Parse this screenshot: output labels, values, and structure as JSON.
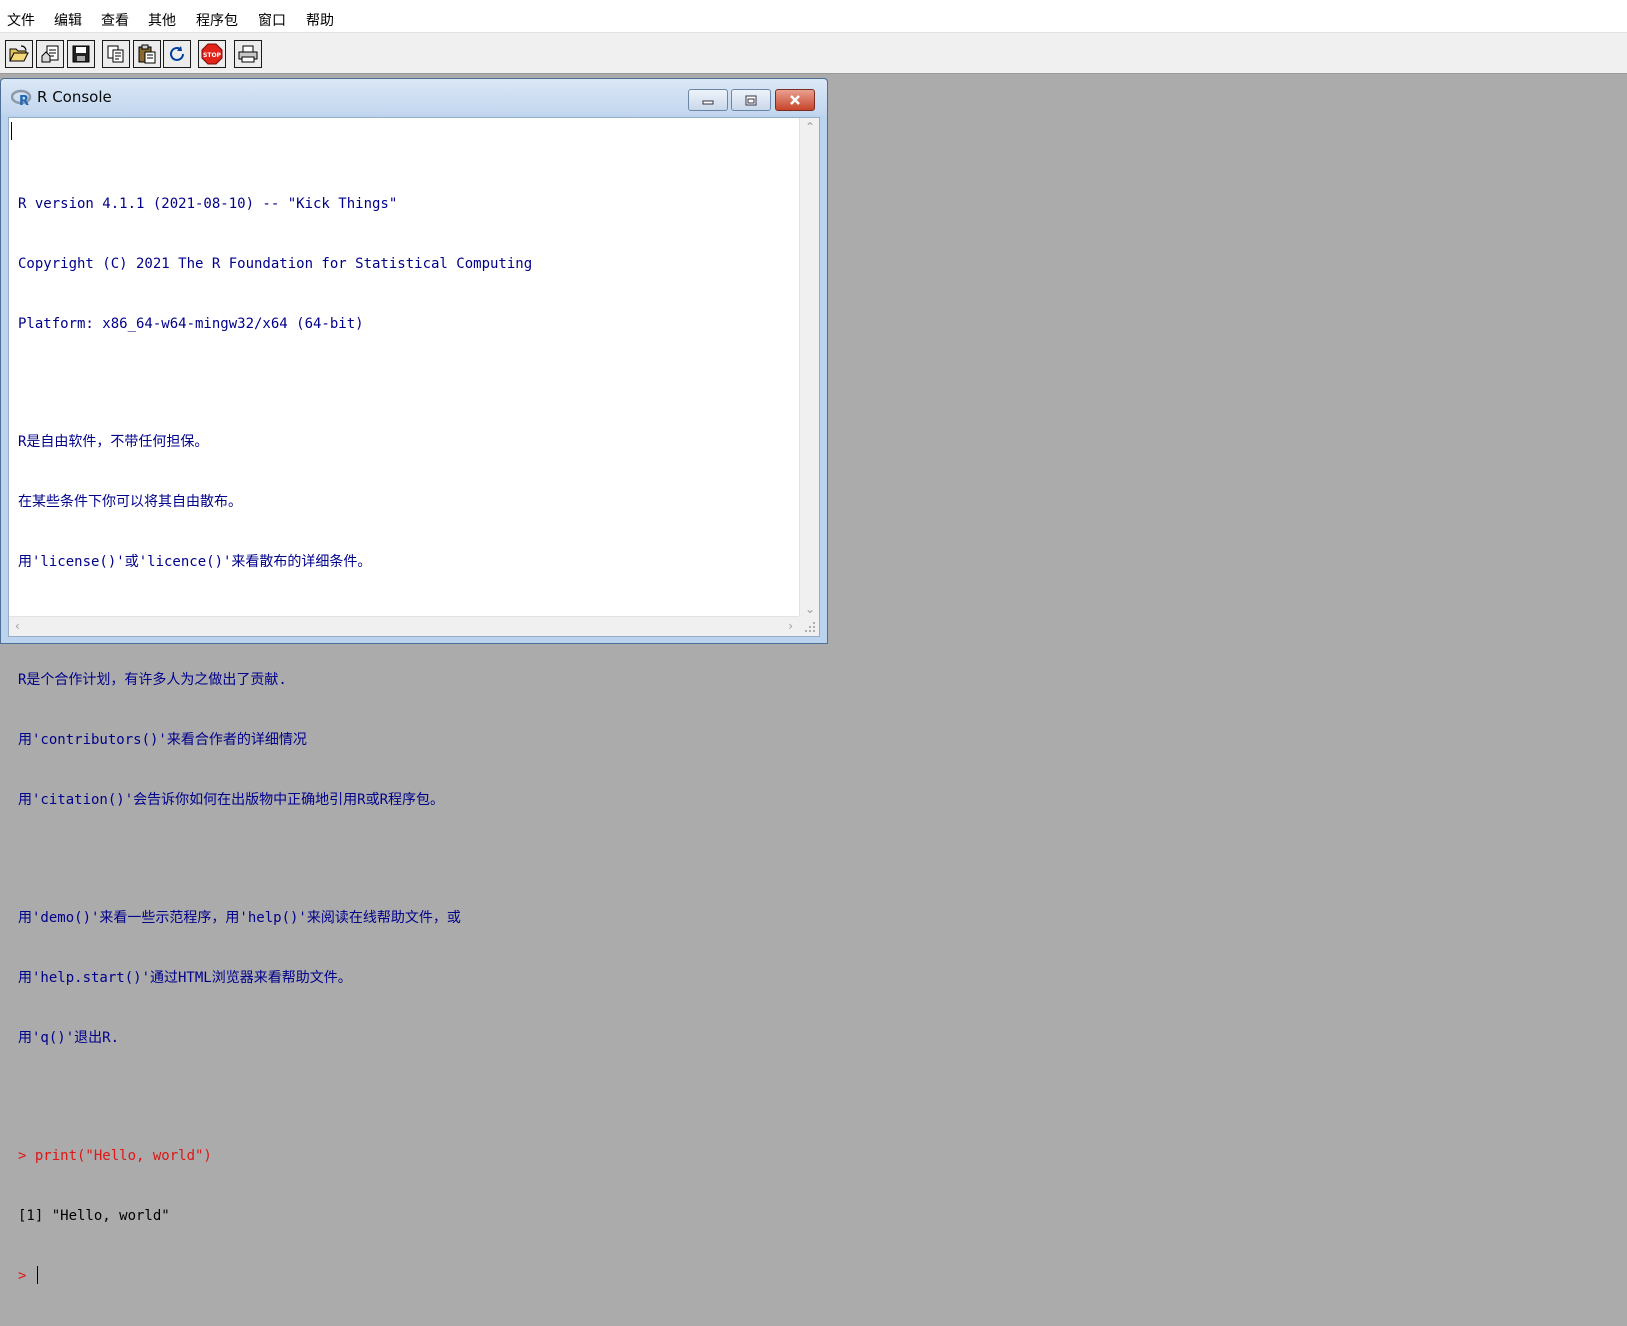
{
  "menubar": {
    "items": [
      "文件",
      "编辑",
      "查看",
      "其他",
      "程序包",
      "窗口",
      "帮助"
    ]
  },
  "toolbar": {
    "buttons": [
      {
        "name": "open-script",
        "icon": "open-folder-icon"
      },
      {
        "name": "load-workspace",
        "icon": "load-icon"
      },
      {
        "name": "save",
        "icon": "floppy-disk-icon"
      },
      {
        "name": "copy",
        "icon": "copy-icon"
      },
      {
        "name": "paste",
        "icon": "paste-icon"
      },
      {
        "name": "copy-paste",
        "icon": "refresh-icon"
      },
      {
        "name": "stop",
        "icon": "stop-sign-icon",
        "label": "STOP"
      },
      {
        "name": "print",
        "icon": "printer-icon"
      }
    ]
  },
  "console": {
    "title": "R Console",
    "logo": "R",
    "startup_lines": [
      "R version 4.1.1 (2021-08-10) -- \"Kick Things\"",
      "Copyright (C) 2021 The R Foundation for Statistical Computing",
      "Platform: x86_64-w64-mingw32/x64 (64-bit)",
      "",
      "R是自由软件，不带任何担保。",
      "在某些条件下你可以将其自由散布。",
      "用'license()'或'licence()'来看散布的详细条件。",
      "",
      "R是个合作计划，有许多人为之做出了贡献.",
      "用'contributors()'来看合作者的详细情况",
      "用'citation()'会告诉你如何在出版物中正确地引用R或R程序包。",
      "",
      "用'demo()'来看一些示范程序，用'help()'来阅读在线帮助文件，或",
      "用'help.start()'通过HTML浏览器来看帮助文件。",
      "用'q()'退出R.",
      ""
    ],
    "command": "> print(\"Hello, world\")",
    "output": "[1] \"Hello, world\"",
    "prompt": ">"
  },
  "colors": {
    "startup_text": "#00008b",
    "command_text": "#e01515",
    "output_text": "#000000",
    "workspace_bg": "#ababab"
  }
}
